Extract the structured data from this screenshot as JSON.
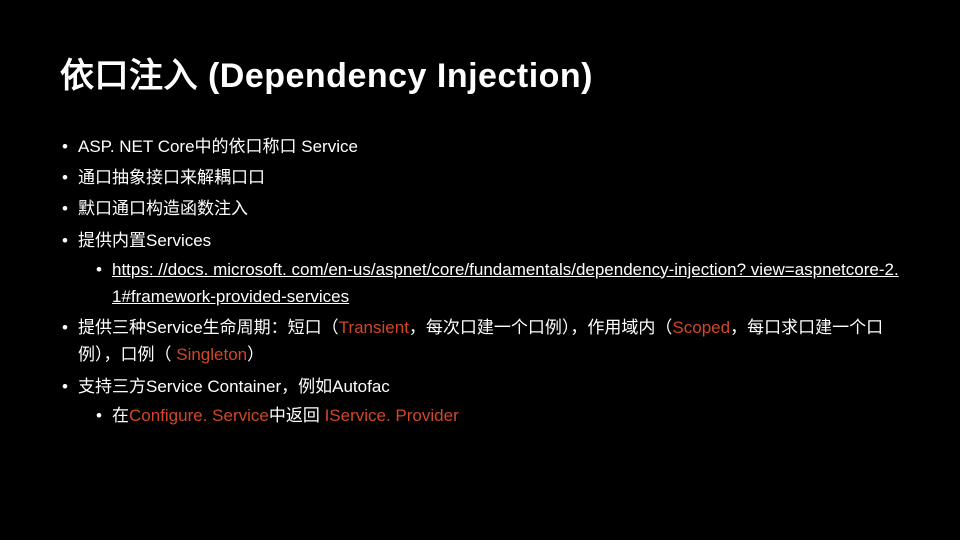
{
  "title": "依口注入 (Dependency Injection)",
  "bullets": {
    "b1": "ASP. NET Core中的依口称口 Service",
    "b2": "通口抽象接口来解耦口口",
    "b3": "默口通口构造函数注入",
    "b4": "提供内置Services",
    "b4_link": "https: //docs. microsoft. com/en-us/aspnet/core/fundamentals/dependency-injection? view=aspnetcore-2. 1#framework-provided-services",
    "b5_pre": "提供三种Service生命周期：短口（",
    "b5_transient": "Transient",
    "b5_mid1": "，每次口建一个口例），作用域内（",
    "b5_scoped": "Scoped",
    "b5_mid2": "，每口求口建一个口例），口例（ ",
    "b5_singleton": "Singleton",
    "b5_tail": "）",
    "b6": "支持三方Service Container，例如Autofac",
    "b6_sub_pre": "在",
    "b6_sub_configure": "Configure. Service",
    "b6_sub_mid": "中返回 ",
    "b6_sub_iservice": "IService. Provider"
  }
}
